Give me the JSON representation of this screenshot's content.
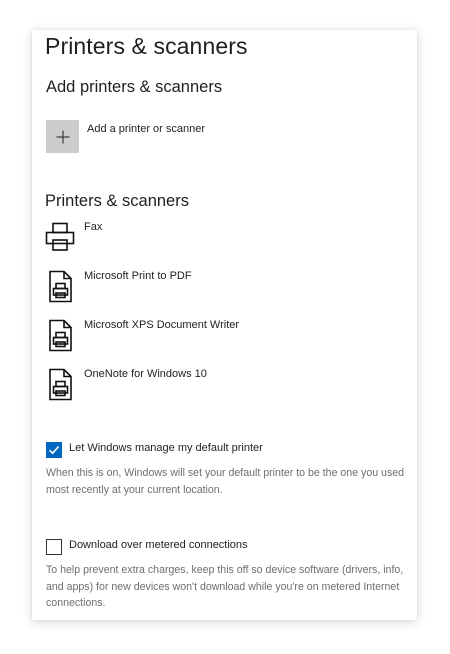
{
  "page": {
    "title": "Printers & scanners"
  },
  "add_section": {
    "heading": "Add printers & scanners",
    "add_label": "Add a printer or scanner",
    "add_icon": "plus-icon"
  },
  "printers_section": {
    "heading": "Printers & scanners",
    "items": [
      {
        "label": "Fax",
        "icon": "printer-icon"
      },
      {
        "label": "Microsoft Print to PDF",
        "icon": "document-printer-icon"
      },
      {
        "label": "Microsoft XPS Document Writer",
        "icon": "document-printer-icon"
      },
      {
        "label": "OneNote for Windows 10",
        "icon": "document-printer-icon"
      }
    ]
  },
  "default_printer": {
    "label": "Let Windows manage my default printer",
    "checked": true,
    "description": "When this is on, Windows will set your default printer to be the one you used most recently at your current location."
  },
  "metered": {
    "label": "Download over metered connections",
    "checked": false,
    "description": "To help prevent extra charges, keep this off so device software (drivers, info, and apps) for new devices won't download while you're on metered Internet connections."
  },
  "colors": {
    "accent": "#0067c0",
    "tile_bg": "#cccccc",
    "text": "#1f1f1f",
    "secondary_text": "#6e6e6e"
  }
}
